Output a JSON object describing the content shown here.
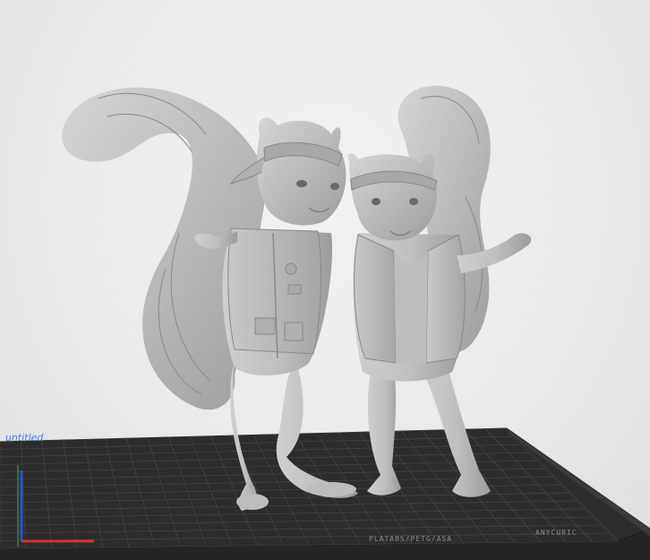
{
  "viewport": {
    "background": "#ebebeb",
    "plate_label_left": "untitled",
    "plate_label_bottom_1": "PLATABS/PETG/ASA",
    "plate_label_bottom_2": "ANYCUBIC"
  },
  "scene": {
    "model_description_icon": "squirrel-duo-model",
    "build_plate_color": "#2a2a2a",
    "grid_line_color": "#555555",
    "axis_x_color": "#d43030",
    "axis_y_color": "#3050d4",
    "model_color": "#b8b8b8"
  }
}
